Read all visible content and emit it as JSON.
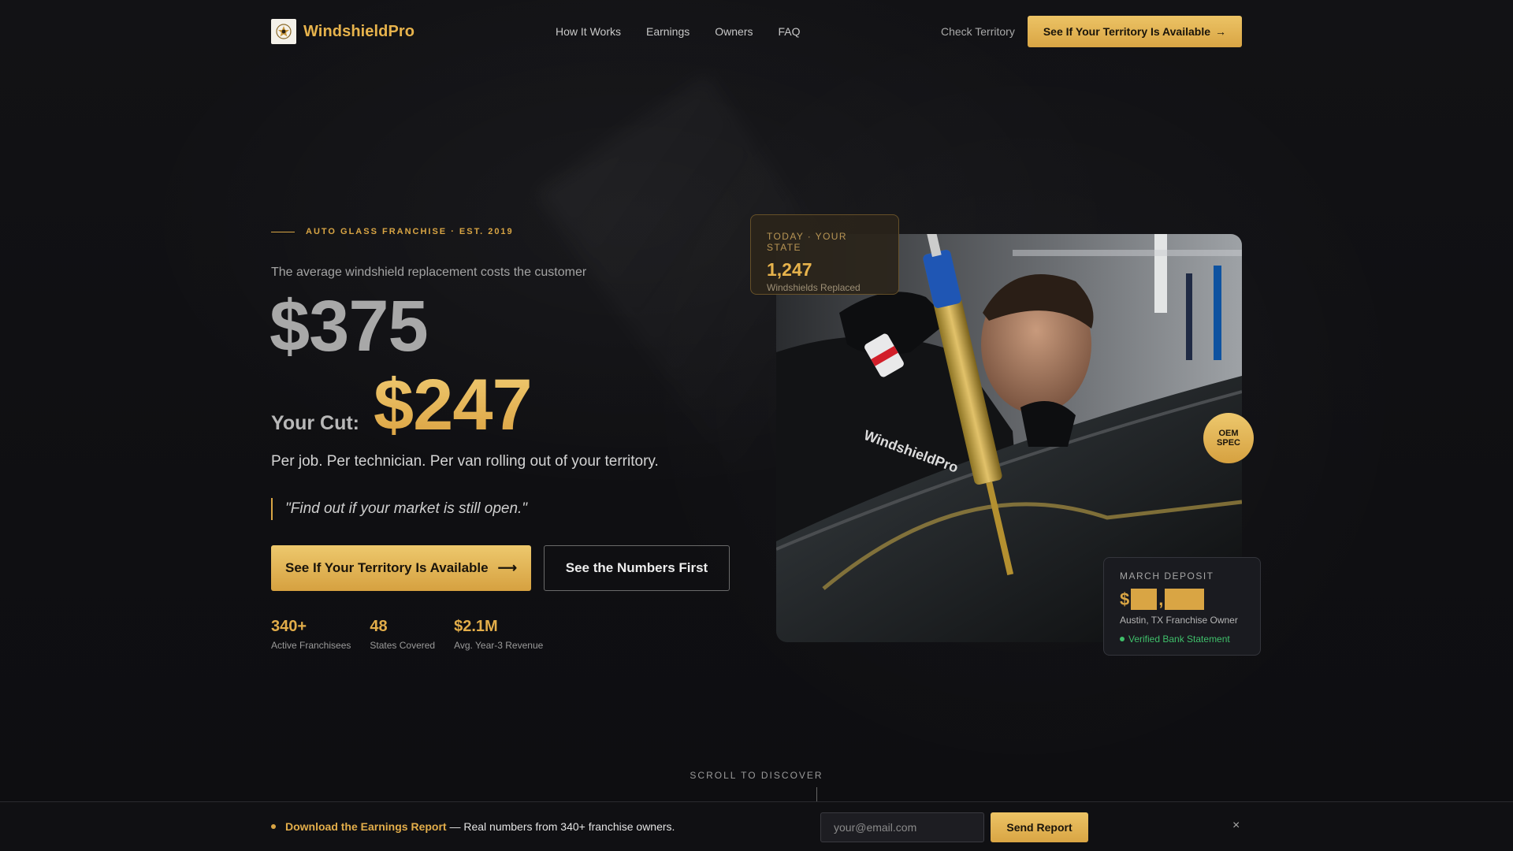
{
  "nav": {
    "brand": "WindshieldPro",
    "links": [
      "How It Works",
      "Earnings",
      "Owners",
      "FAQ"
    ],
    "check_territory": "Check Territory",
    "cta": "See If Your Territory Is Available",
    "cta_arrow": "→"
  },
  "hero": {
    "eyebrow": "AUTO GLASS FRANCHISE · EST. 2019",
    "subhead": "The average windshield replacement costs the customer",
    "price_old": "$375",
    "cut_label": "Your Cut:",
    "price_new": "$247",
    "perjob": "Per job. Per technician. Per van rolling out of your territory.",
    "quote": "\"Find out if your market is still open.\"",
    "cta_primary": "See If Your Territory Is Available",
    "cta_primary_arrow": "⟶",
    "cta_secondary": "See the Numbers First",
    "stats": [
      {
        "value": "340+",
        "label": "Active Franchisees"
      },
      {
        "value": "48",
        "label": "States Covered"
      },
      {
        "value": "$2.1M",
        "label": "Avg. Year-3 Revenue"
      }
    ]
  },
  "floating_card": {
    "label": "TODAY · YOUR STATE",
    "value": "1,247",
    "sub": "Windshields Replaced"
  },
  "badge": {
    "line1": "OEM",
    "line2": "SPEC"
  },
  "deposit_card": {
    "label": "MARCH DEPOSIT",
    "dollar": "$",
    "comma": ",",
    "owner": "Austin, TX Franchise Owner",
    "verified": "Verified Bank Statement"
  },
  "scroll": {
    "label": "SCROLL TO DISCOVER"
  },
  "bottom_bar": {
    "link": "Download the Earnings Report",
    "text": " — Real numbers from 340+ franchise owners.",
    "email_placeholder": "your@email.com",
    "send": "Send Report",
    "close": "×"
  },
  "colors": {
    "gold": "#d9a544",
    "background": "#0f0f12",
    "verified_green": "#3fbf6a"
  },
  "photo": {
    "shirt_text": "WindshieldPro"
  }
}
